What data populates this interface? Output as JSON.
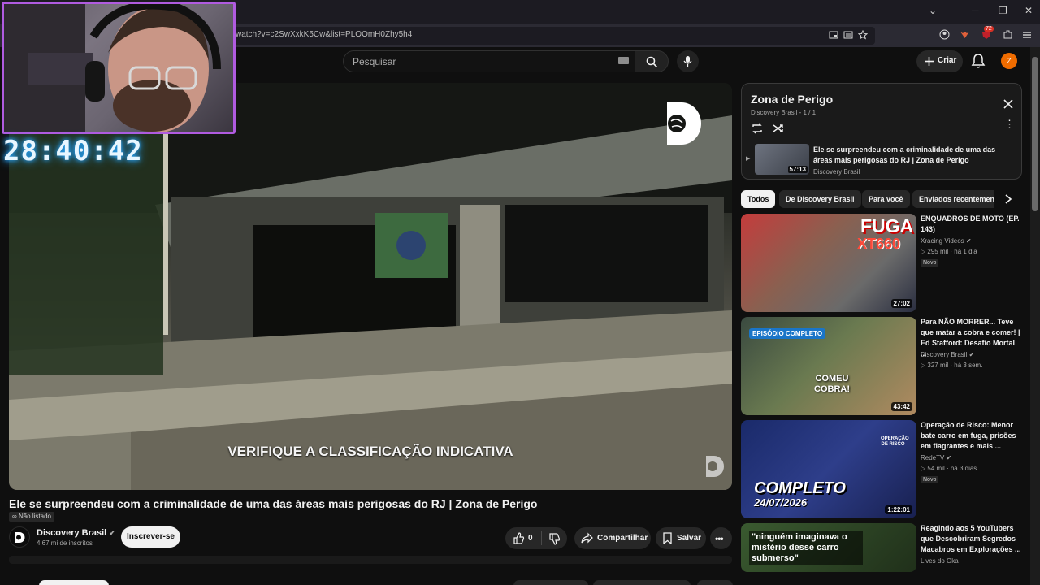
{
  "browser": {
    "url": "watch?v=c2SwXxkK5Cw&list=PLOOmH0Zhy5h4",
    "extension_badge": "72",
    "controls": {
      "minimize": "─",
      "restore": "❐",
      "close": "✕",
      "chevron": "⌄"
    }
  },
  "stream_overlay": {
    "timer": "28:40:42"
  },
  "header": {
    "search_placeholder": "Pesquisar",
    "create_label": "Criar",
    "avatar_letter": "Z"
  },
  "player": {
    "rating_text": "VERIFIQUE A CLASSIFICAÇÃO INDICATIVA"
  },
  "video": {
    "title": "Ele se surpreendeu com a criminalidade de uma das áreas mais perigosas do RJ | Zona de Perigo",
    "unlisted_label": "Não listado",
    "channel_name": "Discovery Brasil",
    "subscribers": "4,67 mi de inscritos",
    "subscribe_label": "Inscrever-se",
    "likes": "0",
    "share_label": "Compartilhar",
    "save_label": "Salvar"
  },
  "playlist": {
    "title": "Zona de Perigo",
    "channel": "Discovery Brasil",
    "position": "1 / 1",
    "item": {
      "title": "Ele se surpreendeu com a criminalidade de uma das áreas mais perigosas do RJ | Zona de Perigo",
      "channel": "Discovery Brasil",
      "duration": "57:13"
    }
  },
  "chips": [
    "Todos",
    "De Discovery Brasil",
    "Para você",
    "Enviados recentemente"
  ],
  "recommendations": [
    {
      "title": "ENQUADROS DE MOTO (EP. 143)",
      "channel": "Xracing Videos",
      "views": "295 mil",
      "age": "há 1 dia",
      "badge": "Novo",
      "duration": "27:02",
      "thumb_text_1": "FUGA",
      "thumb_text_2": "XT660"
    },
    {
      "title": "Para NÃO MORRER... Teve que matar a cobra e comer! | Ed Stafford: Desafio Mortal ...",
      "channel": "Discovery Brasil",
      "views": "327 mil",
      "age": "há 3 sem.",
      "badge": "",
      "duration": "43:42",
      "thumb_text_1": "EPISÓDIO COMPLETO",
      "thumb_text_2": "COMEU COBRA!"
    },
    {
      "title": "Operação de Risco: Menor bate carro em fuga, prisões em flagrantes e mais ...",
      "channel": "RedeTV",
      "views": "54 mil",
      "age": "há 3 dias",
      "badge": "Novo",
      "duration": "1:22:01",
      "thumb_text_1": "COMPLETO",
      "thumb_text_2": "24/07/2026",
      "thumb_text_3": "OPERAÇÃO DE RISCO"
    },
    {
      "title": "Reagindo aos 5 YouTubers que Descobriram Segredos Macabros em Explorações ...",
      "channel": "Lives do Oka",
      "views": "",
      "age": "",
      "badge": "",
      "duration": "",
      "thumb_text_1": "\"ninguém imaginava o mistério desse carro submerso\""
    }
  ],
  "colors": {
    "background": "#0f0f0f",
    "accent_red": "#ff0000",
    "webcam_border": "#b05be0",
    "timer_glow": "#27a6ff",
    "avatar": "#ef6c00"
  },
  "icons": [
    "search-icon",
    "mic-icon",
    "plus-icon",
    "bell-icon",
    "close-icon",
    "loop-icon",
    "shuffle-icon",
    "more-vert-icon",
    "thumb-up-icon",
    "thumb-down-icon",
    "share-icon",
    "save-icon",
    "chevron-right-icon",
    "verified-icon"
  ]
}
